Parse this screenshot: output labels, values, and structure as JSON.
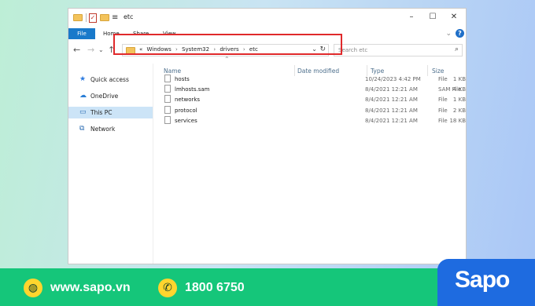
{
  "window": {
    "title": "etc",
    "ribbon_tabs": [
      "File",
      "Home",
      "Share",
      "View"
    ]
  },
  "address": {
    "prefix": "«",
    "crumbs": [
      "Windows",
      "System32",
      "drivers",
      "etc"
    ],
    "separator": "›"
  },
  "search": {
    "placeholder": "Search etc"
  },
  "nav_pane": {
    "items": [
      {
        "label": "Quick access",
        "icon": "star-icon",
        "selected": false
      },
      {
        "label": "OneDrive",
        "icon": "cloud-icon",
        "selected": false
      },
      {
        "label": "This PC",
        "icon": "computer-icon",
        "selected": true
      },
      {
        "label": "Network",
        "icon": "network-icon",
        "selected": false
      }
    ]
  },
  "file_list": {
    "columns": [
      "Name",
      "Date modified",
      "Type",
      "Size"
    ],
    "rows": [
      {
        "name": "hosts",
        "date": "10/24/2023 4:42 PM",
        "type": "File",
        "size": "1 KB"
      },
      {
        "name": "lmhosts.sam",
        "date": "8/4/2021 12:21 AM",
        "type": "SAM File",
        "size": "4 KB"
      },
      {
        "name": "networks",
        "date": "8/4/2021 12:21 AM",
        "type": "File",
        "size": "1 KB"
      },
      {
        "name": "protocol",
        "date": "8/4/2021 12:21 AM",
        "type": "File",
        "size": "2 KB"
      },
      {
        "name": "services",
        "date": "8/4/2021 12:21 AM",
        "type": "File",
        "size": "18 KB"
      }
    ]
  },
  "footer": {
    "website": "www.sapo.vn",
    "phone": "1800 6750",
    "brand": "Sapo"
  },
  "colors": {
    "highlight": "#e0292b",
    "footer_bg": "#15c67a",
    "brand_bg": "#1e6be0",
    "accent": "#1979ca"
  }
}
